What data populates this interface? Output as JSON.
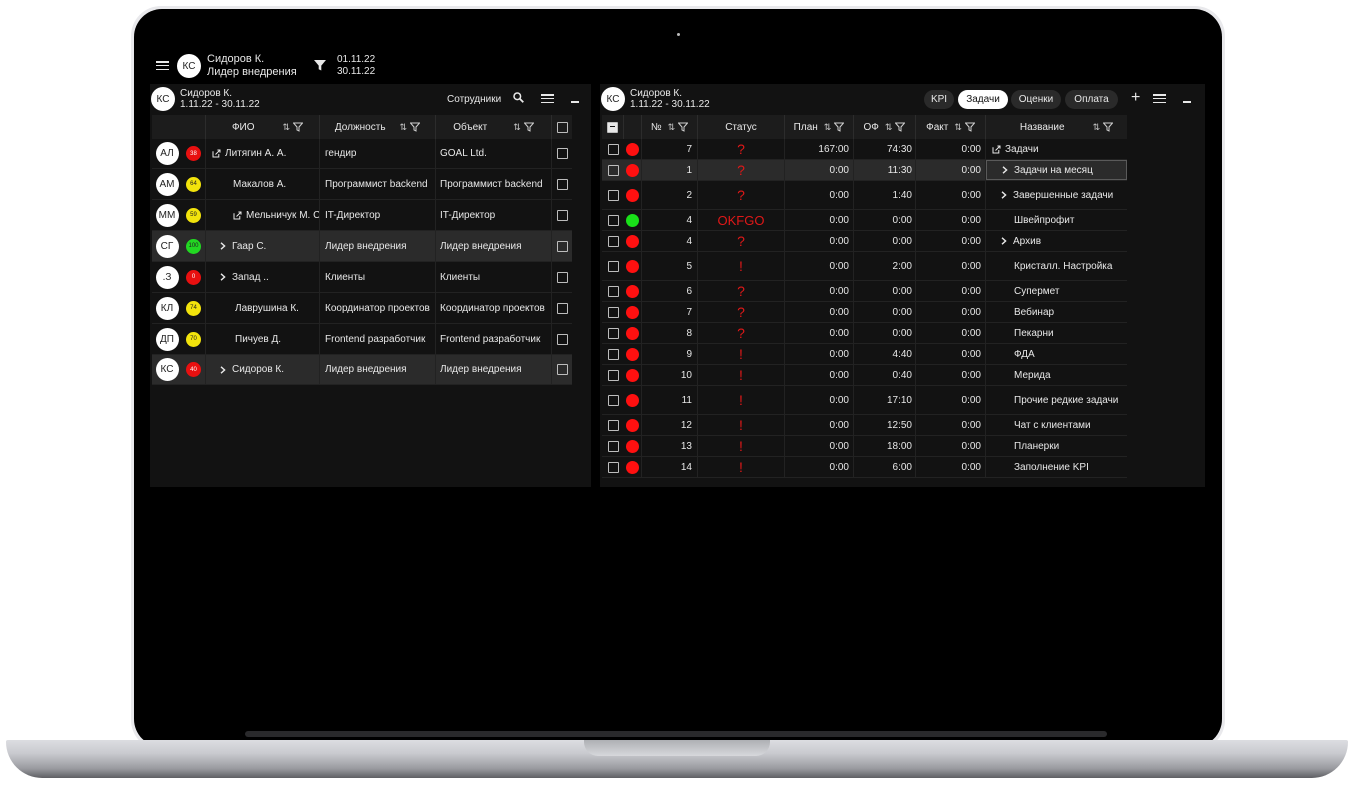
{
  "header": {
    "avatar": "КС",
    "user_name": "Сидоров К.",
    "user_role": "Лидер внедрения",
    "date_from": "01.11.22",
    "date_to": "30.11.22"
  },
  "left_panel": {
    "avatar": "КС",
    "user_name": "Сидоров К.",
    "period": "1.11.22 - 30.11.22",
    "title": "Сотрудники",
    "columns": {
      "name": "ФИО",
      "position": "Должность",
      "object": "Объект"
    },
    "rows": [
      {
        "initials": "АЛ",
        "score": "38",
        "score_color": "#e81010",
        "score_text_color": "#ffffff",
        "indent": 0,
        "prefix": "edit",
        "name": "Литягин А. А.",
        "position": "гендир",
        "object": "GOAL Ltd."
      },
      {
        "initials": "АМ",
        "score": "64",
        "score_color": "#f2e30c",
        "score_text_color": "#222222",
        "indent": 1,
        "prefix": "",
        "name": "Макалов А.",
        "position": "Программист backend",
        "object": "Программист backend"
      },
      {
        "initials": "ММ",
        "score": "59",
        "score_color": "#f2e30c",
        "score_text_color": "#222222",
        "indent": 1,
        "prefix": "edit",
        "name": "Мельничук М. С.",
        "position": "IT-Директор",
        "object": "IT-Директор"
      },
      {
        "initials": "СГ",
        "score": "100",
        "score_color": "#22d822",
        "score_text_color": "#222222",
        "indent": 2,
        "prefix": "chevron",
        "name": "Гаар С.",
        "position": "Лидер внедрения",
        "object": "Лидер внедрения"
      },
      {
        "initials": ".З",
        "score": "0",
        "score_color": "#e81010",
        "score_text_color": "#ffffff",
        "indent": 2,
        "prefix": "chevron",
        "name": "Запад ..",
        "position": "Клиенты",
        "object": "Клиенты"
      },
      {
        "initials": "КЛ",
        "score": "74",
        "score_color": "#f2e30c",
        "score_text_color": "#222222",
        "indent": 3,
        "prefix": "",
        "name": "Лаврушина К.",
        "position": "Координатор проектов",
        "object": "Координатор проектов"
      },
      {
        "initials": "ДП",
        "score": "70",
        "score_color": "#f2e30c",
        "score_text_color": "#222222",
        "indent": 3,
        "prefix": "",
        "name": "Пичуев Д.",
        "position": "Frontend разработчик",
        "object": "Frontend разработчик"
      },
      {
        "initials": "КС",
        "score": "40",
        "score_color": "#e81010",
        "score_text_color": "#ffffff",
        "indent": 2,
        "prefix": "chevron",
        "name": "Сидоров К.",
        "position": "Лидер внедрения",
        "object": "Лидер внедрения"
      }
    ]
  },
  "right_panel": {
    "avatar": "КС",
    "user_name": "Сидоров К.",
    "period": "1.11.22 - 30.11.22",
    "tabs": [
      "KPI",
      "Задачи",
      "Оценки",
      "Оплата"
    ],
    "active_tab": "Задачи",
    "columns": {
      "num": "№",
      "status": "Статус",
      "plan": "План",
      "of": "ОФ",
      "fact": "Факт",
      "name": "Название"
    },
    "rows": [
      {
        "dot": "#ff1010",
        "num": "7",
        "status": "?",
        "plan": "167:00",
        "of": "74:30",
        "fact": "0:00",
        "prefix": "edit",
        "name": "Задачи"
      },
      {
        "dot": "#ff1010",
        "num": "1",
        "status": "?",
        "plan": "0:00",
        "of": "11:30",
        "fact": "0:00",
        "prefix": "chevron",
        "name": "Задачи на месяц"
      },
      {
        "dot": "#ff1010",
        "num": "2",
        "status": "?",
        "plan": "0:00",
        "of": "1:40",
        "fact": "0:00",
        "prefix": "chevron",
        "name": "Завершенные задачи"
      },
      {
        "dot": "#19e019",
        "num": "4",
        "status": "OKFGO",
        "plan": "0:00",
        "of": "0:00",
        "fact": "0:00",
        "prefix": "",
        "name": "Швейпрофит"
      },
      {
        "dot": "#ff1010",
        "num": "4",
        "status": "?",
        "plan": "0:00",
        "of": "0:00",
        "fact": "0:00",
        "prefix": "chevron",
        "name": "Архив"
      },
      {
        "dot": "#ff1010",
        "num": "5",
        "status": "!",
        "plan": "0:00",
        "of": "2:00",
        "fact": "0:00",
        "prefix": "",
        "name": "Кристалл. Настройка"
      },
      {
        "dot": "#ff1010",
        "num": "6",
        "status": "?",
        "plan": "0:00",
        "of": "0:00",
        "fact": "0:00",
        "prefix": "",
        "name": "Супермет"
      },
      {
        "dot": "#ff1010",
        "num": "7",
        "status": "?",
        "plan": "0:00",
        "of": "0:00",
        "fact": "0:00",
        "prefix": "",
        "name": "Вебинар"
      },
      {
        "dot": "#ff1010",
        "num": "8",
        "status": "?",
        "plan": "0:00",
        "of": "0:00",
        "fact": "0:00",
        "prefix": "",
        "name": "Пекарни"
      },
      {
        "dot": "#ff1010",
        "num": "9",
        "status": "!",
        "plan": "0:00",
        "of": "4:40",
        "fact": "0:00",
        "prefix": "",
        "name": "ФДА"
      },
      {
        "dot": "#ff1010",
        "num": "10",
        "status": "!",
        "plan": "0:00",
        "of": "0:40",
        "fact": "0:00",
        "prefix": "",
        "name": "Мерида"
      },
      {
        "dot": "#ff1010",
        "num": "11",
        "status": "!",
        "plan": "0:00",
        "of": "17:10",
        "fact": "0:00",
        "prefix": "",
        "name": "Прочие редкие задачи"
      },
      {
        "dot": "#ff1010",
        "num": "12",
        "status": "!",
        "plan": "0:00",
        "of": "12:50",
        "fact": "0:00",
        "prefix": "",
        "name": "Чат с клиентами"
      },
      {
        "dot": "#ff1010",
        "num": "13",
        "status": "!",
        "plan": "0:00",
        "of": "18:00",
        "fact": "0:00",
        "prefix": "",
        "name": "Планерки"
      },
      {
        "dot": "#ff1010",
        "num": "14",
        "status": "!",
        "plan": "0:00",
        "of": "6:00",
        "fact": "0:00",
        "prefix": "",
        "name": "Заполнение KPI"
      }
    ]
  }
}
